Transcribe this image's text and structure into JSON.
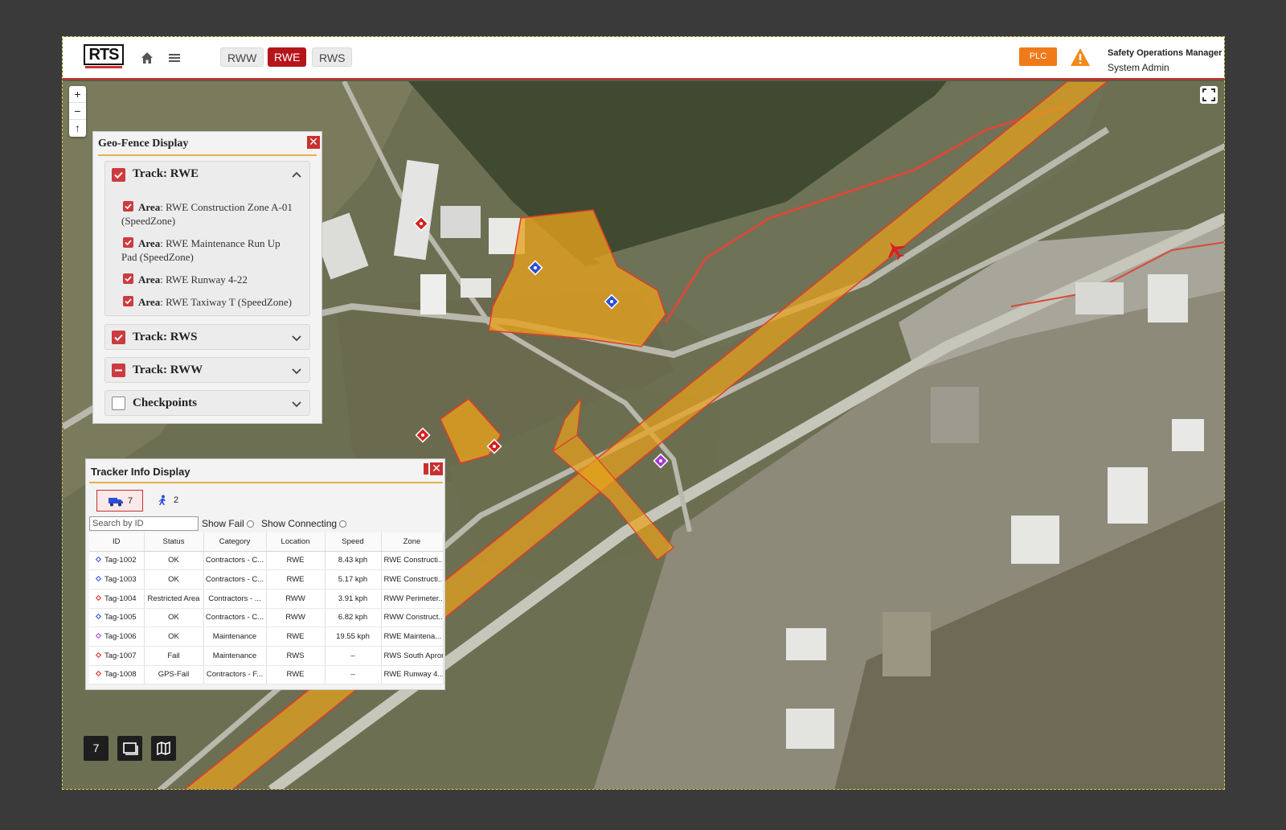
{
  "header": {
    "logo_text": "RTS",
    "tabs": [
      {
        "label": "RWW",
        "active": false
      },
      {
        "label": "RWE",
        "active": true
      },
      {
        "label": "RWS",
        "active": false
      }
    ],
    "plc_label": "PLC",
    "user_title": "Safety Operations Manager",
    "user_role": "System Admin",
    "accent_color": "#b5141b",
    "warning_color": "#f07a1a"
  },
  "map_controls": {
    "zoom_in": "+",
    "zoom_out": "−",
    "reset_north": "↑"
  },
  "geofence_panel": {
    "title": "Geo-Fence Display",
    "close": "✕",
    "tracks": [
      {
        "label": "Track: RWE",
        "state": "checked",
        "expanded": true,
        "areas": [
          {
            "prefix": "Area",
            "text": ": RWE Construction Zone A-01 (SpeedZone)"
          },
          {
            "prefix": "Area",
            "text": ": RWE Maintenance Run Up Pad (SpeedZone)"
          },
          {
            "prefix": "Area",
            "text": ": RWE Runway 4-22"
          },
          {
            "prefix": "Area",
            "text": ": RWE Taxiway T (SpeedZone)"
          }
        ]
      },
      {
        "label": "Track: RWS",
        "state": "checked",
        "expanded": false
      },
      {
        "label": "Track: RWW",
        "state": "partial",
        "expanded": false
      },
      {
        "label": "Checkpoints",
        "state": "empty",
        "expanded": false
      }
    ]
  },
  "tracker_panel": {
    "title": "Tracker Info Display",
    "close": "✕",
    "vehicle_count": "7",
    "person_count": "2",
    "search_placeholder": "Search by ID",
    "show_fail_label": "Show Fail",
    "show_connecting_label": "Show Connecting",
    "columns": [
      "ID",
      "Status",
      "Category",
      "Location",
      "Speed",
      "Zone"
    ],
    "rows": [
      {
        "color": "#2b4fd6",
        "id": "Tag-1002",
        "status": "OK",
        "category": "Contractors - C...",
        "location": "RWE",
        "speed": "8.43 kph",
        "zone": "RWE Constructi..."
      },
      {
        "color": "#2b4fd6",
        "id": "Tag-1003",
        "status": "OK",
        "category": "Contractors - C...",
        "location": "RWE",
        "speed": "5.17 kph",
        "zone": "RWE Constructi..."
      },
      {
        "color": "#d62020",
        "id": "Tag-1004",
        "status": "Restricted Area",
        "category": "Contractors - ...",
        "location": "RWW",
        "speed": "3.91 kph",
        "zone": "RWW Perimeter..."
      },
      {
        "color": "#2b4fd6",
        "id": "Tag-1005",
        "status": "OK",
        "category": "Contractors - C...",
        "location": "RWW",
        "speed": "6.82 kph",
        "zone": "RWW Construct..."
      },
      {
        "color": "#a43ad0",
        "id": "Tag-1006",
        "status": "OK",
        "category": "Maintenance",
        "location": "RWE",
        "speed": "19.55 kph",
        "zone": "RWE Maintena..."
      },
      {
        "color": "#d62020",
        "id": "Tag-1007",
        "status": "Fail",
        "category": "Maintenance",
        "location": "RWS",
        "speed": "–",
        "zone": "RWS South Apron"
      },
      {
        "color": "#d62020",
        "id": "Tag-1008",
        "status": "GPS-Fail",
        "category": "Contractors - F...",
        "location": "RWE",
        "speed": "–",
        "zone": "RWE Runway 4..."
      }
    ]
  },
  "bottom_controls": {
    "count_label": "7"
  },
  "icons": [
    "home-icon",
    "menu-icon",
    "warning-icon",
    "fullscreen-icon",
    "truck-icon",
    "person-icon",
    "layers-icon",
    "map-icon",
    "airplane-icon"
  ]
}
